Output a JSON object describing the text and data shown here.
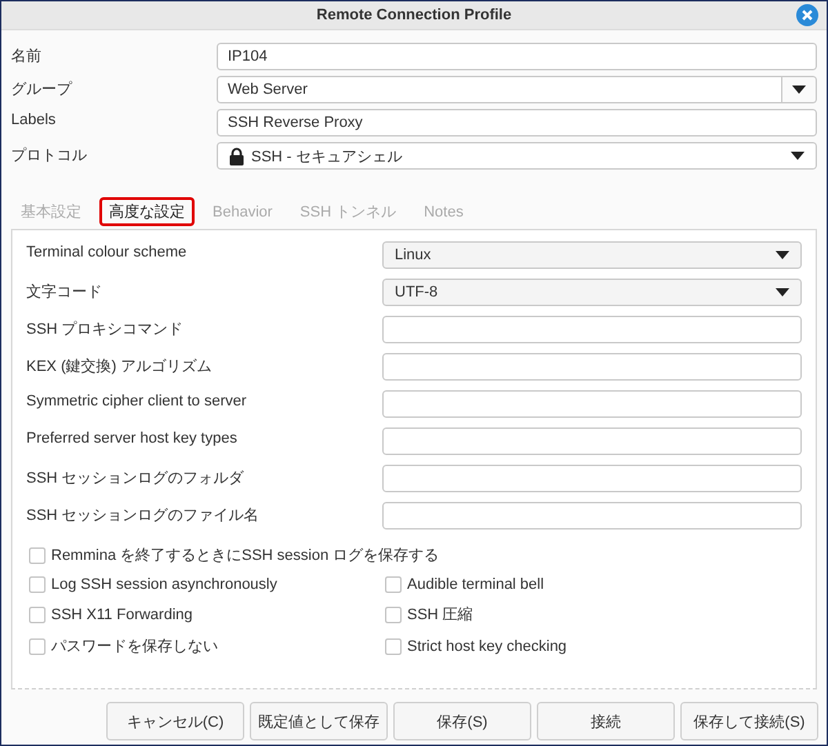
{
  "window": {
    "title": "Remote Connection Profile"
  },
  "profile_fields": [
    {
      "label": "名前",
      "kind": "text",
      "value": "IP104"
    },
    {
      "label": "グループ",
      "kind": "combo",
      "value": "Web Server"
    },
    {
      "label": "Labels",
      "kind": "text",
      "value": "SSH Reverse Proxy"
    },
    {
      "label": "プロトコル",
      "kind": "protocol",
      "value": "SSH - セキュアシェル"
    }
  ],
  "tabs": [
    {
      "label": "基本設定",
      "selected": false
    },
    {
      "label": "高度な設定",
      "selected": true
    },
    {
      "label": "Behavior",
      "selected": false
    },
    {
      "label": "SSH トンネル",
      "selected": false
    },
    {
      "label": "Notes",
      "selected": false
    }
  ],
  "settings": [
    {
      "label": "Terminal colour scheme",
      "kind": "select",
      "value": "Linux"
    },
    {
      "label": "文字コード",
      "kind": "select",
      "value": "UTF-8"
    },
    {
      "label": "SSH プロキシコマンド",
      "kind": "text"
    },
    {
      "label": "KEX (鍵交換) アルゴリズム",
      "kind": "text"
    },
    {
      "label": "Symmetric cipher client to server",
      "kind": "text"
    },
    {
      "label": "Preferred server host key types",
      "kind": "text"
    },
    {
      "label": "SSH セッションログのフォルダ",
      "kind": "text"
    },
    {
      "label": "SSH セッションログのファイル名",
      "kind": "text"
    }
  ],
  "checkbox_rows": [
    [
      {
        "label": "Remmina を終了するときにSSH session ログを保存する",
        "checked": false
      }
    ],
    [
      {
        "label": "Log SSH session asynchronously",
        "checked": false
      },
      {
        "label": "Audible terminal bell",
        "checked": false
      }
    ],
    [
      {
        "label": "SSH X11 Forwarding",
        "checked": false
      },
      {
        "label": "SSH 圧縮",
        "checked": false
      }
    ],
    [
      {
        "label": "パスワードを保存しない",
        "checked": false
      },
      {
        "label": "Strict host key checking",
        "checked": false
      }
    ]
  ],
  "buttons": [
    "キャンセル(C)",
    "既定値として保存",
    "保存(S)",
    "接続",
    "保存して接続(S)"
  ]
}
